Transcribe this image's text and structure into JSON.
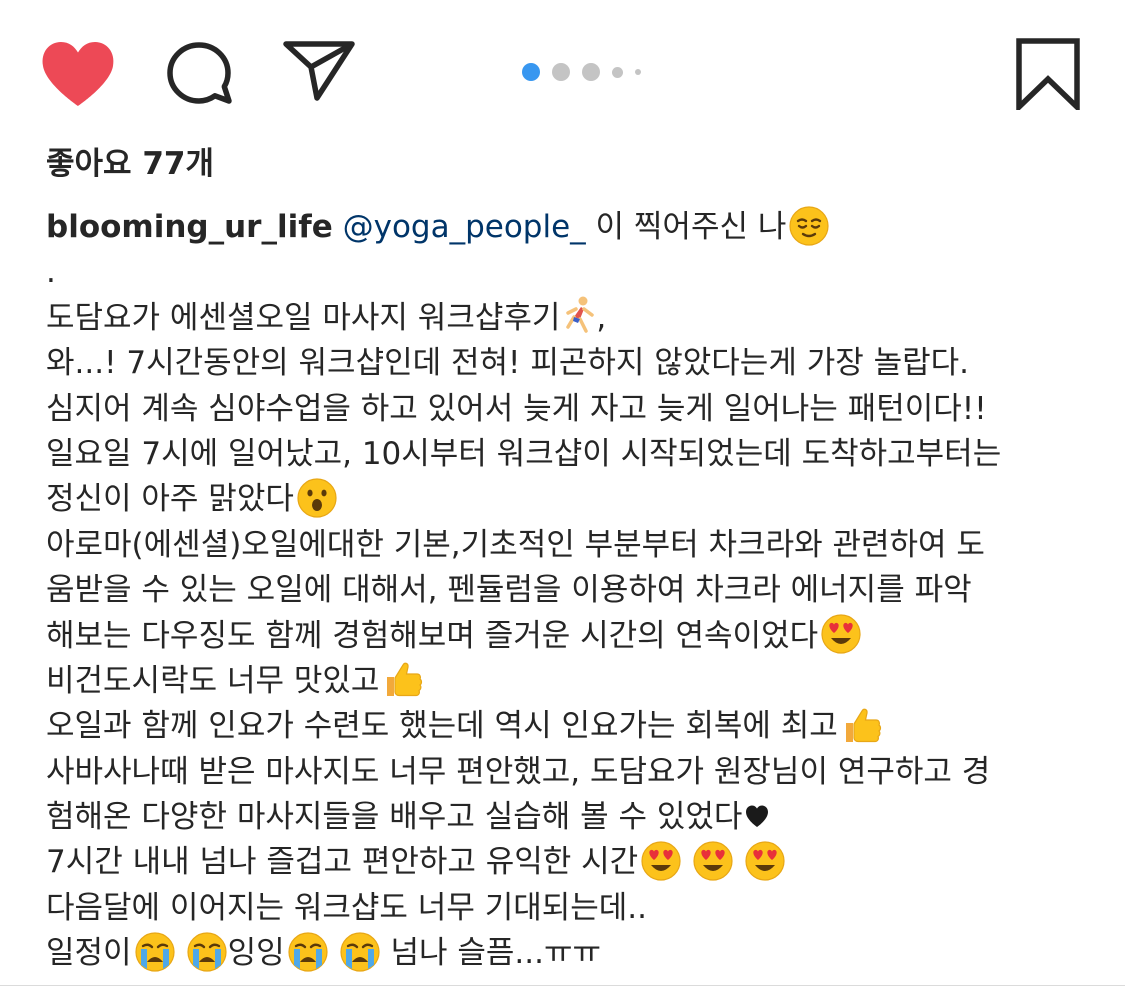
{
  "actions": {
    "like_icon": "heart-filled",
    "comment_icon": "speech-bubble",
    "share_icon": "paper-plane",
    "save_icon": "bookmark",
    "like_color": "#ed4956",
    "icon_color": "#262626"
  },
  "carousel": {
    "total_dots": 5,
    "active_index": 0,
    "active_color": "#3897f0",
    "inactive_color": "#c4c4c4"
  },
  "likes": {
    "text": "좋아요 77개"
  },
  "caption": {
    "username": "blooming_ur_life",
    "mention": "@yoga_people_",
    "mention_color": "#003569",
    "line1_tail": " 이 찍어주신 나",
    "line2": ".",
    "line3": "도담요가 에센셜오일 마사지 워크샵후기",
    "line3_tail": ",",
    "line4": "와...! 7시간동안의 워크샵인데 전혀! 피곤하지 않았다는게 가장 놀랍다.",
    "line5": "심지어 계속 심야수업을 하고 있어서 늦게 자고 늦게 일어나는 패턴이다!!",
    "line6": "일요일 7시에 일어났고, 10시부터 워크샵이 시작되었는데 도착하고부터는",
    "line7": "정신이 아주 맑았다",
    "line8": "아로마(에센셜)오일에대한 기본,기초적인 부분부터 차크라와 관련하여 도",
    "line9": "움받을 수 있는 오일에 대해서, 펜듈럼을 이용하여 차크라 에너지를 파악",
    "line10": "해보는 다우징도 함께 경험해보며 즐거운 시간의 연속이었다",
    "line11": "비건도시락도 너무 맛있고",
    "line12": "오일과 함께 인요가 수련도 했는데 역시 인요가는 회복에 최고",
    "line13": "사바사나때 받은 마사지도 너무 편안했고, 도담요가 원장님이 연구하고 경",
    "line14": "험해온 다양한 마사지들을 배우고 실습해 볼 수 있었다",
    "line15": "7시간 내내 넘나 즐겁고 편안하고 유익한 시간",
    "line16": "다음달에 이어지는 워크샵도 너무 기대되는데..",
    "line17_a": "일정이",
    "line17_b": "잉잉",
    "line17_c": " 넘나 슬픔...ㅠㅠ"
  },
  "emojis": {
    "relieved": "relieved-face",
    "runner": "runner",
    "hushed": "hushed-face",
    "heart_eyes": "heart-eyes-face",
    "thumbs_up": "thumbs-up",
    "black_heart": "black-heart",
    "crying": "loudly-crying-face"
  }
}
